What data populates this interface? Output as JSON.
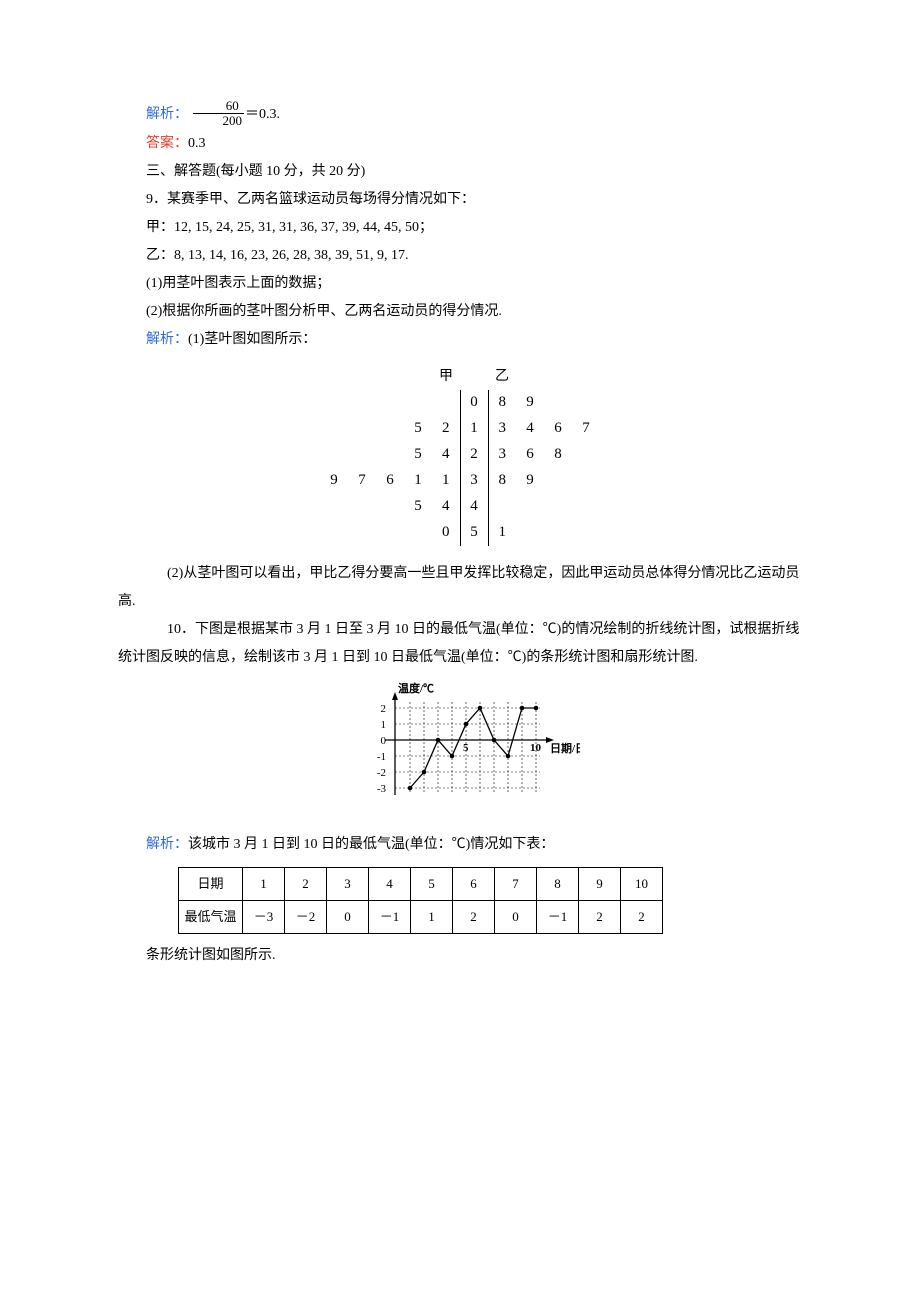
{
  "top": {
    "analysis_label": "解析：",
    "frac_num": "60",
    "frac_den": "200",
    "eq_text": "＝0.3.",
    "answer_label": "答案：",
    "answer_text": "0.3"
  },
  "section3": {
    "heading": "三、解答题(每小题 10 分，共 20 分)"
  },
  "q9": {
    "title": "9．某赛季甲、乙两名篮球运动员每场得分情况如下：",
    "line_jia": "甲：12, 15, 24, 25, 31, 31, 36, 37, 39, 44, 45, 50；",
    "line_yi": "乙：8, 13, 14, 16, 23, 26, 28, 38, 39, 51, 9, 17.",
    "part1": "(1)用茎叶图表示上面的数据；",
    "part2": "(2)根据你所画的茎叶图分析甲、乙两名运动员的得分情况.",
    "analysis_label": "解析：",
    "analysis1": "(1)茎叶图如图所示：",
    "stemleaf": {
      "header_left": "甲",
      "header_right": "乙",
      "rows": [
        {
          "left": [
            "",
            "",
            "",
            "",
            ""
          ],
          "stem": "0",
          "right": [
            "8",
            "9",
            "",
            ""
          ]
        },
        {
          "left": [
            "",
            "",
            "",
            "5",
            "2"
          ],
          "stem": "1",
          "right": [
            "3",
            "4",
            "6",
            "7"
          ]
        },
        {
          "left": [
            "",
            "",
            "",
            "5",
            "4"
          ],
          "stem": "2",
          "right": [
            "3",
            "6",
            "8",
            ""
          ]
        },
        {
          "left": [
            "9",
            "7",
            "6",
            "1",
            "1"
          ],
          "stem": "3",
          "right": [
            "8",
            "9",
            "",
            ""
          ]
        },
        {
          "left": [
            "",
            "",
            "",
            "5",
            "4"
          ],
          "stem": "4",
          "right": [
            "",
            "",
            "",
            ""
          ]
        },
        {
          "left": [
            "",
            "",
            "",
            "",
            "0"
          ],
          "stem": "5",
          "right": [
            "1",
            "",
            "",
            ""
          ]
        }
      ]
    },
    "concl": "(2)从茎叶图可以看出，甲比乙得分要高一些且甲发挥比较稳定，因此甲运动员总体得分情况比乙运动员高."
  },
  "q10": {
    "title": "10．下图是根据某市 3 月 1 日至 3 月 10 日的最低气温(单位：℃)的情况绘制的折线统计图，试根据折线统计图反映的信息，绘制该市 3 月 1 日到 10 日最低气温(单位：℃)的条形统计图和扇形统计图.",
    "chart": {
      "y_label": "温度/℃",
      "x_label": "日期/日",
      "y_ticks": [
        "2",
        "1",
        "0",
        "-1",
        "-2",
        "-3"
      ],
      "x_tick_mid": "5",
      "x_tick_end": "10"
    },
    "analysis_label": "解析：",
    "analysis_text": "该城市 3 月 1 日到 10 日的最低气温(单位：℃)情况如下表：",
    "table": {
      "head_date": "日期",
      "head_temp": "最低气温",
      "dates": [
        "1",
        "2",
        "3",
        "4",
        "5",
        "6",
        "7",
        "8",
        "9",
        "10"
      ],
      "temps": [
        "－3",
        "－2",
        "0",
        "－1",
        "1",
        "2",
        "0",
        "－1",
        "2",
        "2"
      ]
    },
    "end_line": "条形统计图如图所示."
  },
  "chart_data": {
    "type": "line",
    "title": "",
    "xlabel": "日期/日",
    "ylabel": "温度/℃",
    "x": [
      1,
      2,
      3,
      4,
      5,
      6,
      7,
      8,
      9,
      10
    ],
    "y": [
      -3,
      -2,
      0,
      -1,
      1,
      2,
      0,
      -1,
      2,
      2
    ],
    "ylim": [
      -3,
      2
    ],
    "xlim": [
      1,
      10
    ]
  }
}
